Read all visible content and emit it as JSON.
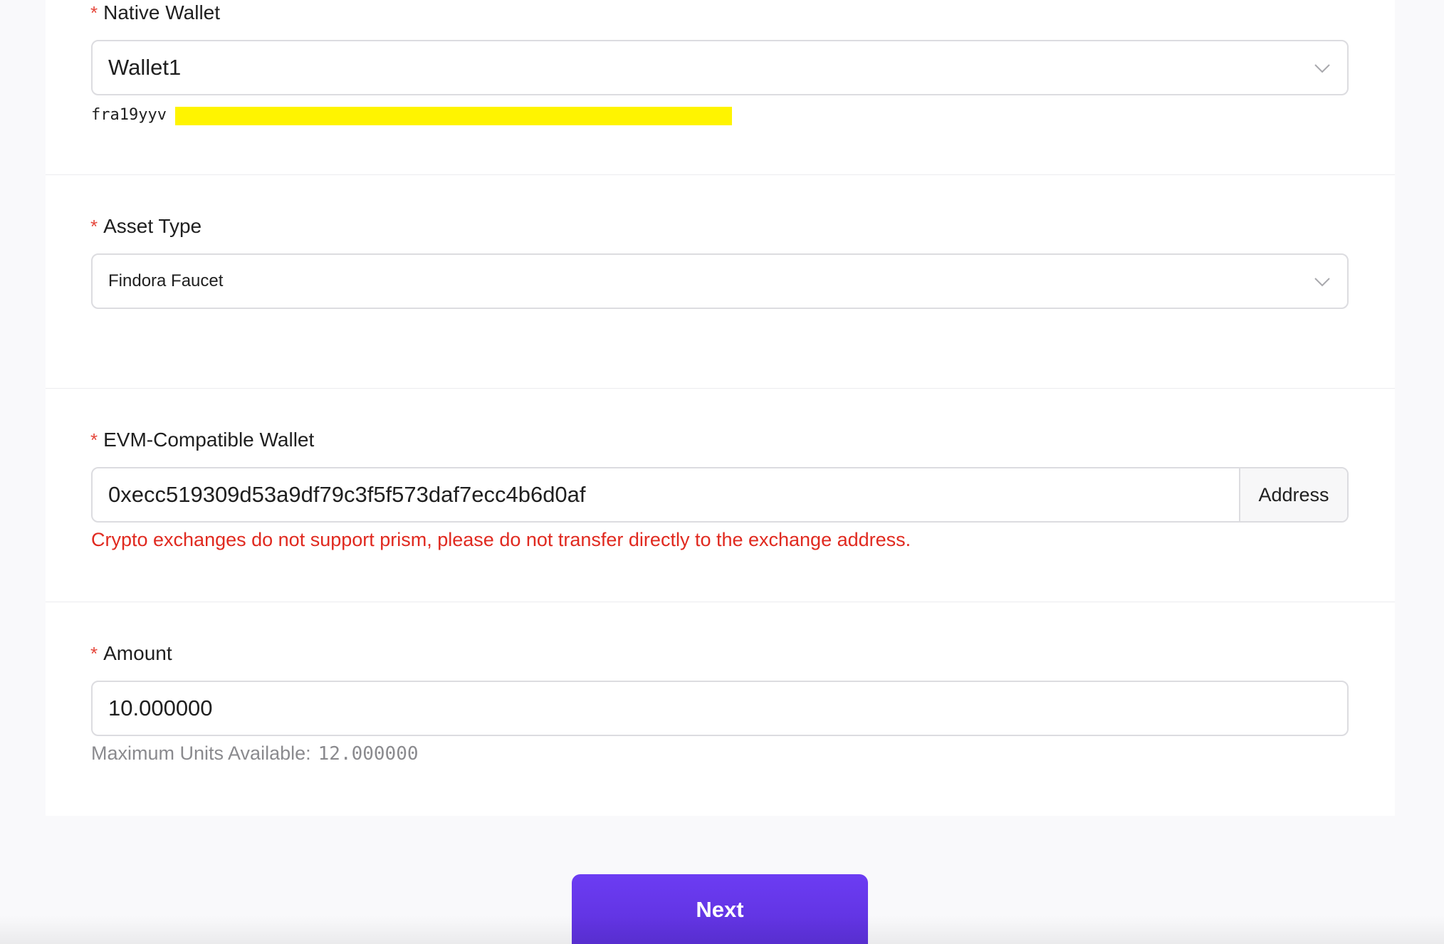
{
  "native_wallet": {
    "label": "Native Wallet",
    "selected": "Wallet1",
    "address_visible_prefix": "fra19yyv"
  },
  "asset_type": {
    "label": "Asset Type",
    "selected": "Findora Faucet"
  },
  "evm_wallet": {
    "label": "EVM-Compatible Wallet",
    "value": "0xecc519309d53a9df79c3f5f573daf7ecc4b6d0af",
    "addon_label": "Address",
    "warning": "Crypto exchanges do not support prism, please do not transfer directly to the exchange address."
  },
  "amount": {
    "label": "Amount",
    "value": "10.000000",
    "max_label": "Maximum Units Available:",
    "max_value": "12.000000"
  },
  "required_marker": "*",
  "next_label": "Next",
  "colors": {
    "accent": "#6c3cf3",
    "required": "#e5463b",
    "warning": "#e0291f",
    "redaction": "#fff400"
  }
}
